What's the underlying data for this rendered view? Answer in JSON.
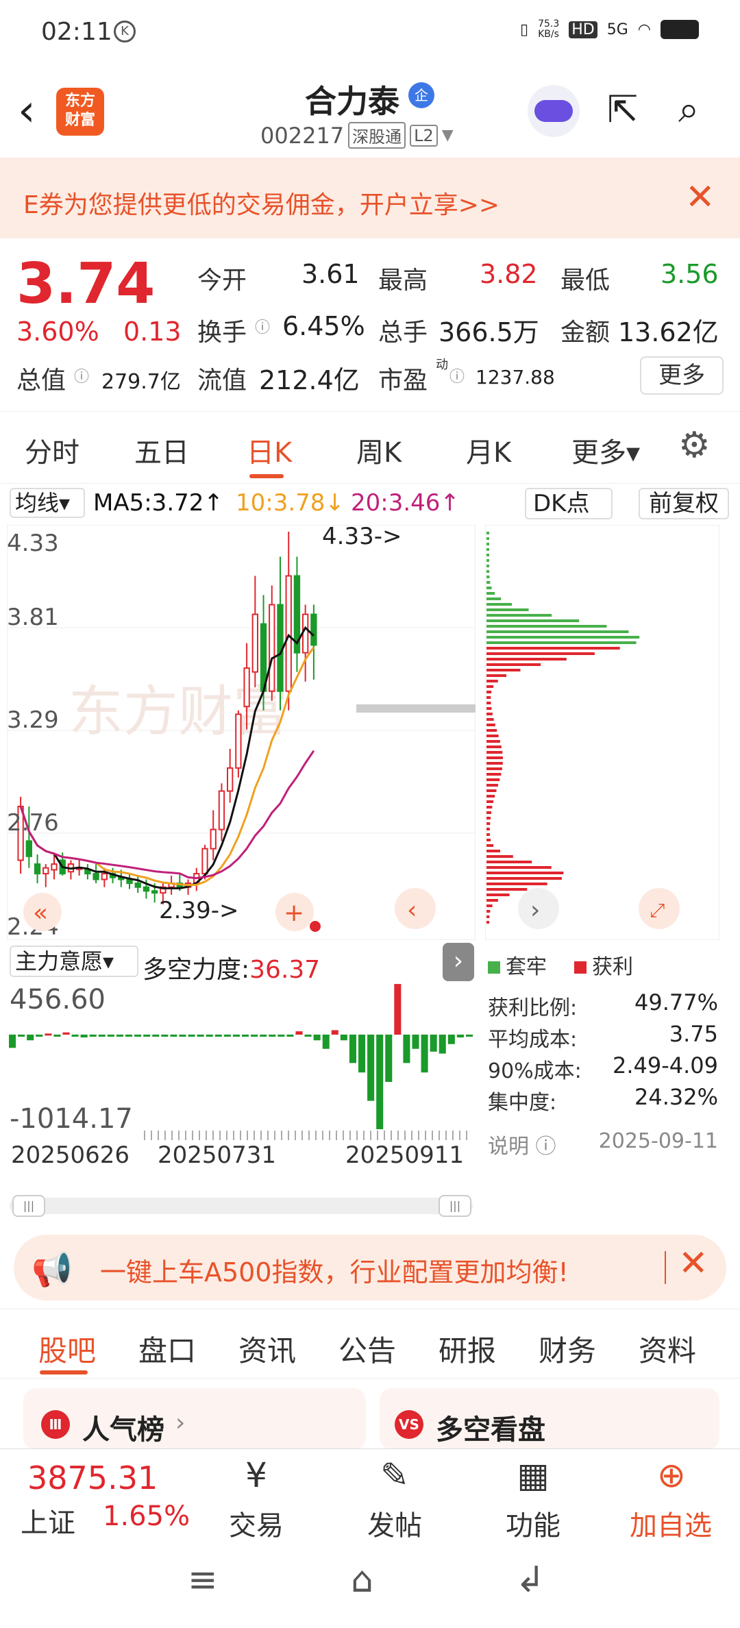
{
  "status_bar": {
    "time": "02:11",
    "k_icon": "K",
    "net_speed": "75.3\nKB/s",
    "hd": "HD",
    "signal": "5G"
  },
  "header": {
    "back_icon": "chevron-left-icon",
    "logo": "东方\n财富",
    "name": "合力泰",
    "badge": "企",
    "code": "002217",
    "tags": [
      "深股通",
      "L2"
    ]
  },
  "top_banner": {
    "text": "E券为您提供更低的交易佣金，开户立享>>",
    "close": "✕"
  },
  "quote": {
    "price": "3.74",
    "change_pct": "3.60%",
    "change": "0.13",
    "open_label": "今开",
    "open": "3.61",
    "high_label": "最高",
    "high": "3.82",
    "low_label": "最低",
    "low": "3.56",
    "turnover_label": "换手",
    "turnover": "6.45%",
    "volume_label": "总手",
    "volume": "366.5万",
    "amount_label": "金额",
    "amount": "13.62亿",
    "mktcap_label": "总值",
    "mktcap": "279.7亿",
    "float_label": "流值",
    "float": "212.4亿",
    "pe_label": "市盈",
    "pe_sup": "动",
    "pe": "1237.88",
    "more": "更多"
  },
  "period_tabs": [
    "分时",
    "五日",
    "日K",
    "周K",
    "月K",
    "更多▾"
  ],
  "active_period": "日K",
  "ma_bar": {
    "label": "均线▾",
    "ma5": "MA5:3.72↑",
    "ma10": "10:3.78↓",
    "ma20": "20:3.46↑",
    "dk": "DK点",
    "fq": "前复权"
  },
  "kchart": {
    "y_labels": [
      "4.33",
      "3.81",
      "3.29",
      "2.76",
      "2.24"
    ],
    "high_note": "4.33->",
    "low_note": "2.39->",
    "watermark": "东方财富"
  },
  "chart_data": {
    "type": "candlestick",
    "ylim": [
      2.24,
      4.33
    ],
    "candles": [
      [
        2.62,
        2.95,
        2.55,
        2.9
      ],
      [
        2.72,
        2.9,
        2.58,
        2.64
      ],
      [
        2.6,
        2.65,
        2.5,
        2.55
      ],
      [
        2.55,
        2.6,
        2.48,
        2.58
      ],
      [
        2.57,
        2.66,
        2.52,
        2.6
      ],
      [
        2.62,
        2.66,
        2.54,
        2.55
      ],
      [
        2.56,
        2.62,
        2.52,
        2.6
      ],
      [
        2.58,
        2.62,
        2.54,
        2.58
      ],
      [
        2.57,
        2.6,
        2.52,
        2.55
      ],
      [
        2.55,
        2.6,
        2.5,
        2.52
      ],
      [
        2.52,
        2.58,
        2.48,
        2.55
      ],
      [
        2.55,
        2.58,
        2.5,
        2.53
      ],
      [
        2.53,
        2.57,
        2.48,
        2.52
      ],
      [
        2.52,
        2.55,
        2.47,
        2.5
      ],
      [
        2.5,
        2.54,
        2.45,
        2.48
      ],
      [
        2.48,
        2.52,
        2.42,
        2.46
      ],
      [
        2.46,
        2.5,
        2.4,
        2.45
      ],
      [
        2.45,
        2.5,
        2.39,
        2.48
      ],
      [
        2.48,
        2.54,
        2.44,
        2.5
      ],
      [
        2.5,
        2.55,
        2.46,
        2.48
      ],
      [
        2.48,
        2.52,
        2.44,
        2.5
      ],
      [
        2.5,
        2.58,
        2.46,
        2.55
      ],
      [
        2.55,
        2.7,
        2.52,
        2.68
      ],
      [
        2.68,
        2.88,
        2.62,
        2.78
      ],
      [
        2.78,
        3.02,
        2.72,
        2.98
      ],
      [
        2.98,
        3.2,
        2.92,
        3.1
      ],
      [
        3.1,
        3.4,
        3.05,
        3.38
      ],
      [
        3.42,
        3.75,
        3.3,
        3.62
      ],
      [
        3.6,
        4.1,
        3.52,
        3.9
      ],
      [
        3.85,
        4.0,
        3.4,
        3.5
      ],
      [
        3.5,
        4.05,
        3.45,
        3.95
      ],
      [
        3.95,
        4.2,
        3.4,
        3.5
      ],
      [
        3.5,
        4.33,
        3.4,
        4.1
      ],
      [
        4.1,
        4.2,
        3.6,
        3.7
      ],
      [
        3.7,
        3.95,
        3.55,
        3.9
      ],
      [
        3.9,
        3.95,
        3.56,
        3.74
      ]
    ],
    "ma5_last": 3.72,
    "ma10_last": 3.78,
    "ma20_last": 3.46,
    "chips": {
      "profit_ratio": "49.77%",
      "avg_cost": "3.75",
      "cost_90": "2.49-4.09",
      "concentration": "24.32%"
    },
    "flow": {
      "y_labels": [
        "456.60",
        "-1014.17"
      ],
      "dates": [
        "20250626",
        "20250731",
        "20250911"
      ],
      "values": [
        -140,
        -20,
        -60,
        -8,
        10,
        -10,
        20,
        -10,
        -30,
        -8,
        -6,
        -4,
        -6,
        -8,
        -6,
        -4,
        -8,
        -6,
        -4,
        -6,
        -8,
        -4,
        -6,
        -2,
        -4,
        -6,
        -4,
        -8,
        -4,
        -6,
        -4,
        -10,
        30,
        -20,
        -60,
        -150,
        40,
        -60,
        -300,
        -400,
        -700,
        -1000,
        -500,
        456,
        -300,
        -150,
        -400,
        -180,
        -200,
        -100,
        -30,
        -10
      ]
    }
  },
  "lower": {
    "label": "主力意愿▾",
    "dk_label": "多空力度:",
    "dk_value": "36.37",
    "arrow": "›"
  },
  "chips_panel": {
    "legend_trapped": "套牢",
    "legend_profit": "获利",
    "rows": [
      {
        "label": "获利比例:",
        "value": "49.77%"
      },
      {
        "label": "平均成本:",
        "value": "3.75"
      },
      {
        "label": "90%成本:",
        "value": "2.49-4.09"
      },
      {
        "label": "集中度:",
        "value": "24.32%"
      }
    ],
    "note_label": "说明",
    "note_date": "2025-09-11"
  },
  "ad_banner": {
    "text": "一键上车A500指数，行业配置更加均衡!",
    "close": "✕"
  },
  "bottom_tabs": [
    "股吧",
    "盘口",
    "资讯",
    "公告",
    "研报",
    "财务",
    "资料"
  ],
  "active_bottom": "股吧",
  "cards": [
    {
      "title": "人气榜",
      "icon": "Ⅲ"
    },
    {
      "title": "多空看盘",
      "icon": "VS"
    }
  ],
  "bottom_nav": {
    "index_value": "3875.31",
    "index_name": "上证",
    "index_pct": "1.65%",
    "items": [
      {
        "icon": "¥",
        "label": "交易"
      },
      {
        "icon": "✎",
        "label": "发帖"
      },
      {
        "icon": "▦",
        "label": "功能"
      },
      {
        "icon": "⊕",
        "label": "加自选"
      }
    ]
  },
  "colors": {
    "accent": "#e8522a",
    "up": "#e0262e",
    "down": "#1a9a2a",
    "ma5": "#111111",
    "ma10": "#f0a020",
    "ma20": "#c0207a"
  }
}
